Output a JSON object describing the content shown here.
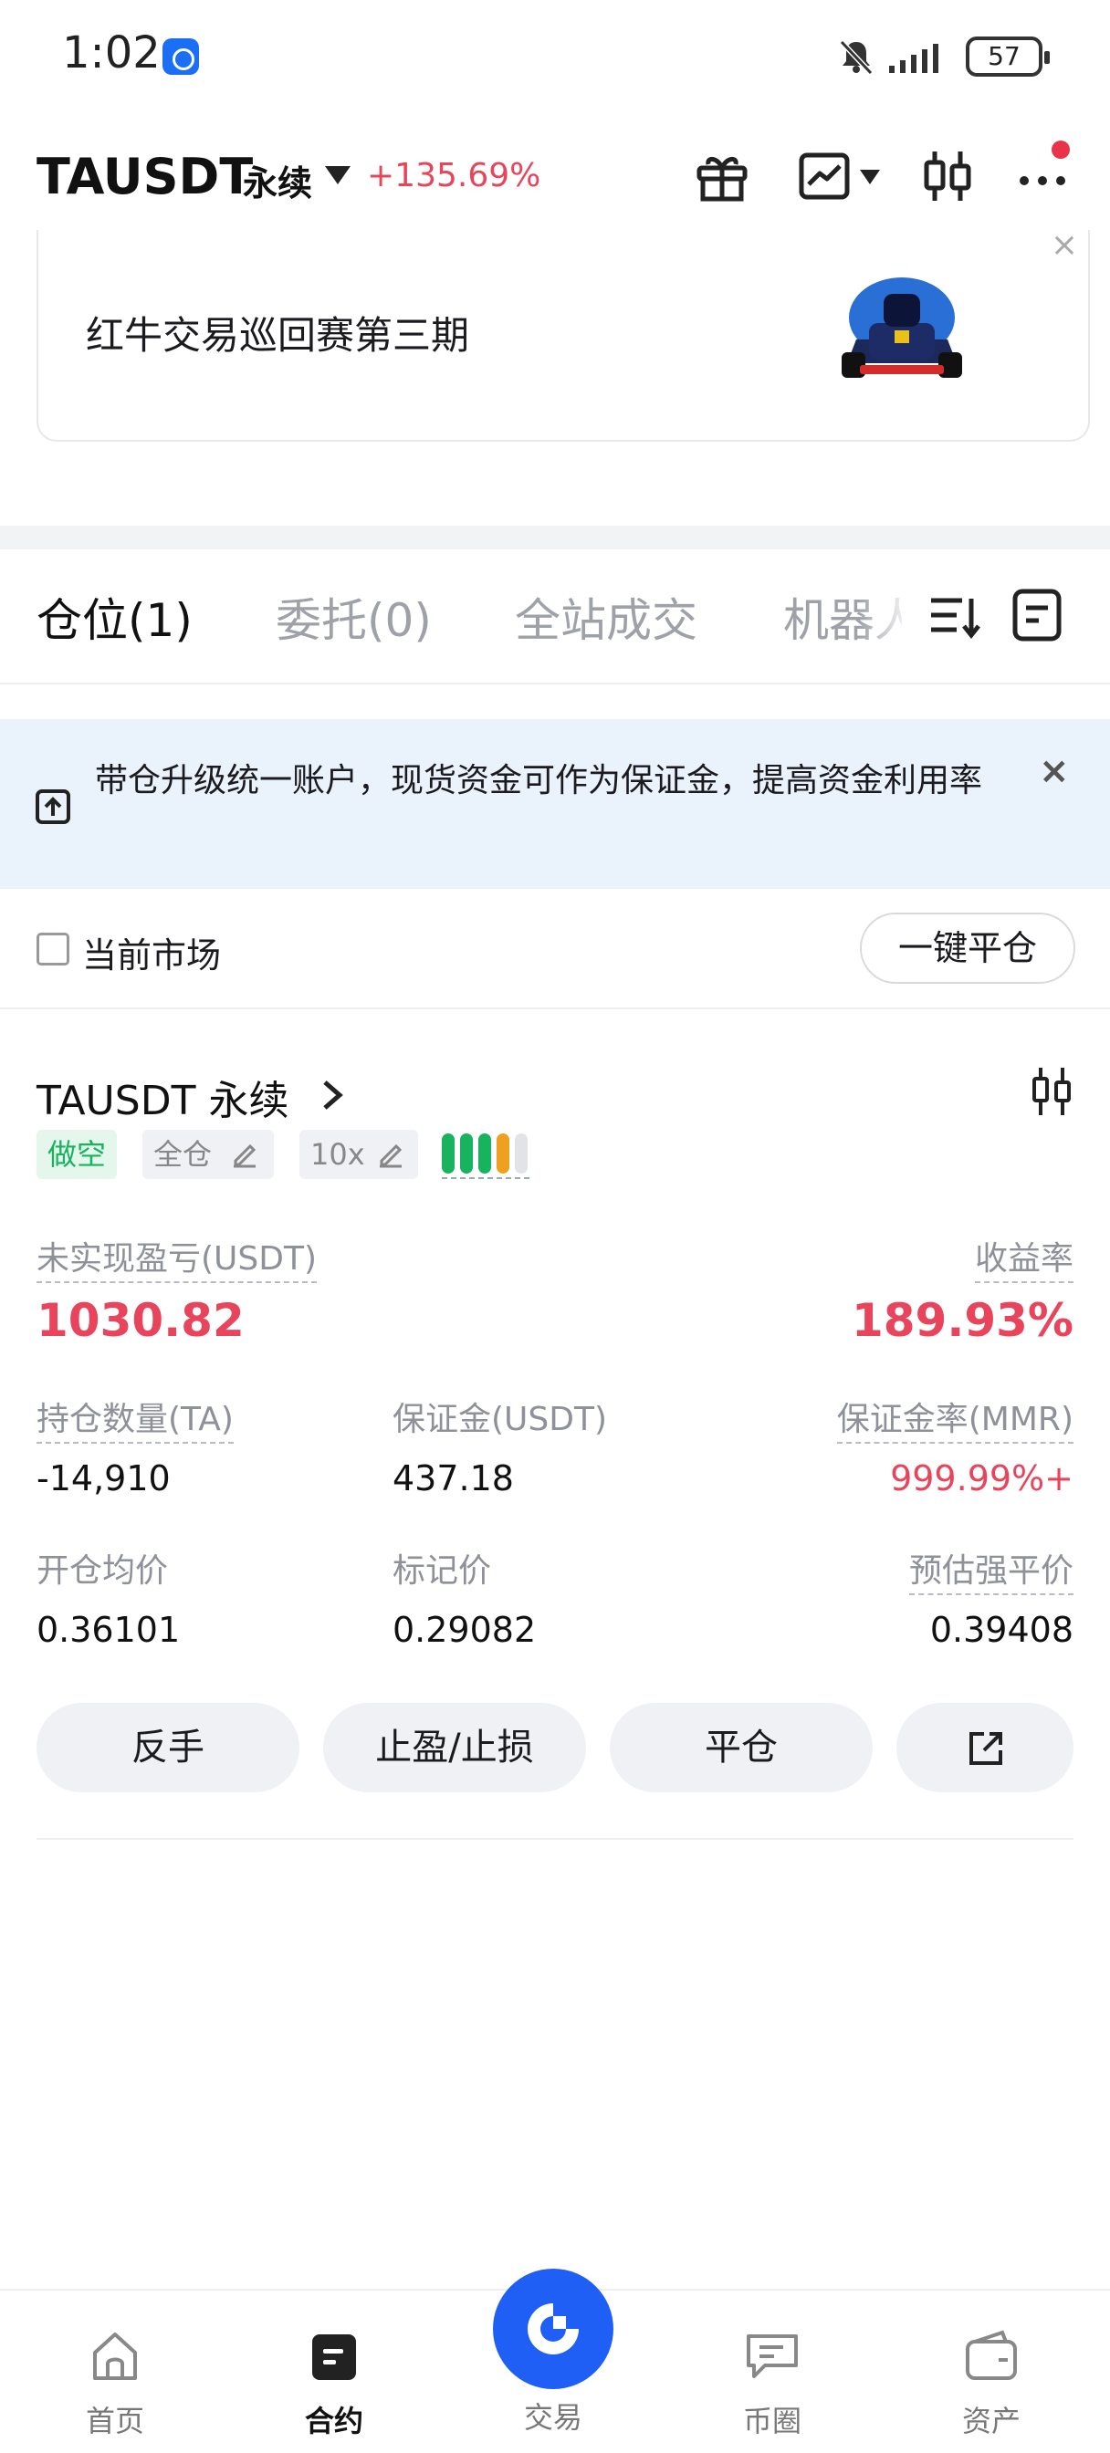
{
  "status_bar": {
    "time": "1:02",
    "battery": "57"
  },
  "header": {
    "symbol": "TAUSDT",
    "type": "永续",
    "change": "+135.69%"
  },
  "promo": {
    "text": "红牛交易巡回赛第三期",
    "close": "×"
  },
  "tabs": [
    {
      "label": "仓位(1)"
    },
    {
      "label": "委托(0)"
    },
    {
      "label": "全站成交"
    },
    {
      "label": "机器人"
    }
  ],
  "notice": {
    "text": "带仓升级统一账户，现货资金可作为保证金，提高资金利用率",
    "close": "×"
  },
  "filter": {
    "checkbox_label": "当前市场",
    "close_all": "一键平仓"
  },
  "position": {
    "title": "TAUSDT 永续",
    "side_tag": "做空",
    "margin_mode": "全仓",
    "leverage": "10x",
    "adl_level": 4,
    "unrealized_label": "未实现盈亏(USDT)",
    "unrealized_value": "1030.82",
    "roe_label": "收益率",
    "roe_value": "189.93%",
    "qty_label": "持仓数量(TA)",
    "qty_value": "-14,910",
    "margin_label": "保证金(USDT)",
    "margin_value": "437.18",
    "mmr_label": "保证金率(MMR)",
    "mmr_value": "999.99%+",
    "entry_label": "开仓均价",
    "entry_value": "0.36101",
    "mark_label": "标记价",
    "mark_value": "0.29082",
    "liq_label": "预估强平价",
    "liq_value": "0.39408",
    "actions": {
      "reverse": "反手",
      "tpsl": "止盈/止损",
      "close": "平仓"
    }
  },
  "bottom_nav": [
    {
      "label": "首页",
      "icon": "home-icon"
    },
    {
      "label": "合约",
      "icon": "contract-icon"
    },
    {
      "label": "交易",
      "icon": "trade-icon"
    },
    {
      "label": "币圈",
      "icon": "chat-icon"
    },
    {
      "label": "资产",
      "icon": "wallet-icon"
    }
  ],
  "colors": {
    "accent": "#1f5ff5",
    "red": "#e8455c",
    "green": "#17b35f",
    "adl_orange": "#f0a020"
  }
}
